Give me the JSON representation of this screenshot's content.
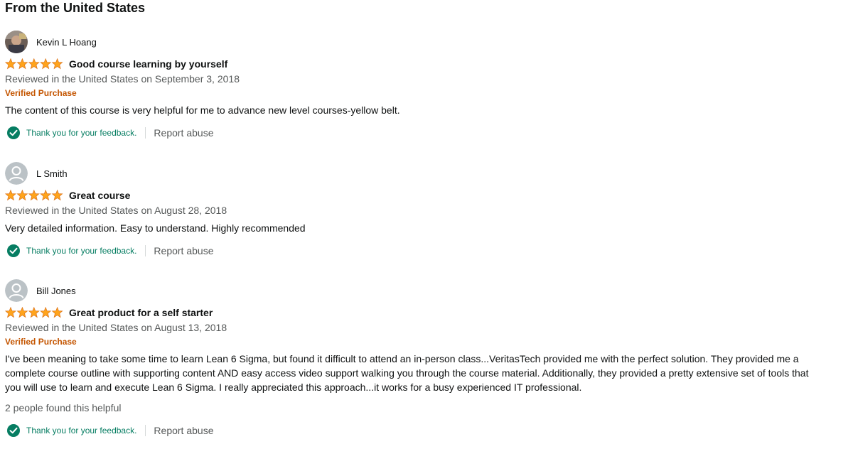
{
  "section": {
    "title": "From the United States"
  },
  "colors": {
    "star": "#ffa41c",
    "verified": "#c45500",
    "thanks": "#067d62",
    "muted": "#565959"
  },
  "reviews": [
    {
      "reviewer": "Kevin L Hoang",
      "avatar": "photo",
      "rating": 5,
      "title": "Good course learning by yourself",
      "date": "Reviewed in the United States on September 3, 2018",
      "verified": "Verified Purchase",
      "body": "The content of this course is very helpful for me to advance new level courses-yellow belt.",
      "thanks": "Thank you for your feedback.",
      "report": "Report abuse"
    },
    {
      "reviewer": "L Smith",
      "avatar": "default-avatar-icon",
      "rating": 5,
      "title": "Great course",
      "date": "Reviewed in the United States on August 28, 2018",
      "body": "Very detailed information. Easy to understand. Highly recommended",
      "thanks": "Thank you for your feedback.",
      "report": "Report abuse"
    },
    {
      "reviewer": "Bill Jones",
      "avatar": "default-avatar-icon",
      "rating": 5,
      "title": "Great product for a self starter",
      "date": "Reviewed in the United States on August 13, 2018",
      "verified": "Verified Purchase",
      "body": "I've been meaning to take some time to learn Lean 6 Sigma, but found it difficult to attend an in-person class...VeritasTech provided me with the perfect solution. They provided me a complete course outline with supporting content AND easy access video support walking you through the course material. Additionally, they provided a pretty extensive set of tools that you will use to learn and execute Lean 6 Sigma. I really appreciated this approach...it works for a busy experienced IT professional.",
      "helpful": "2 people found this helpful",
      "thanks": "Thank you for your feedback.",
      "report": "Report abuse"
    }
  ]
}
